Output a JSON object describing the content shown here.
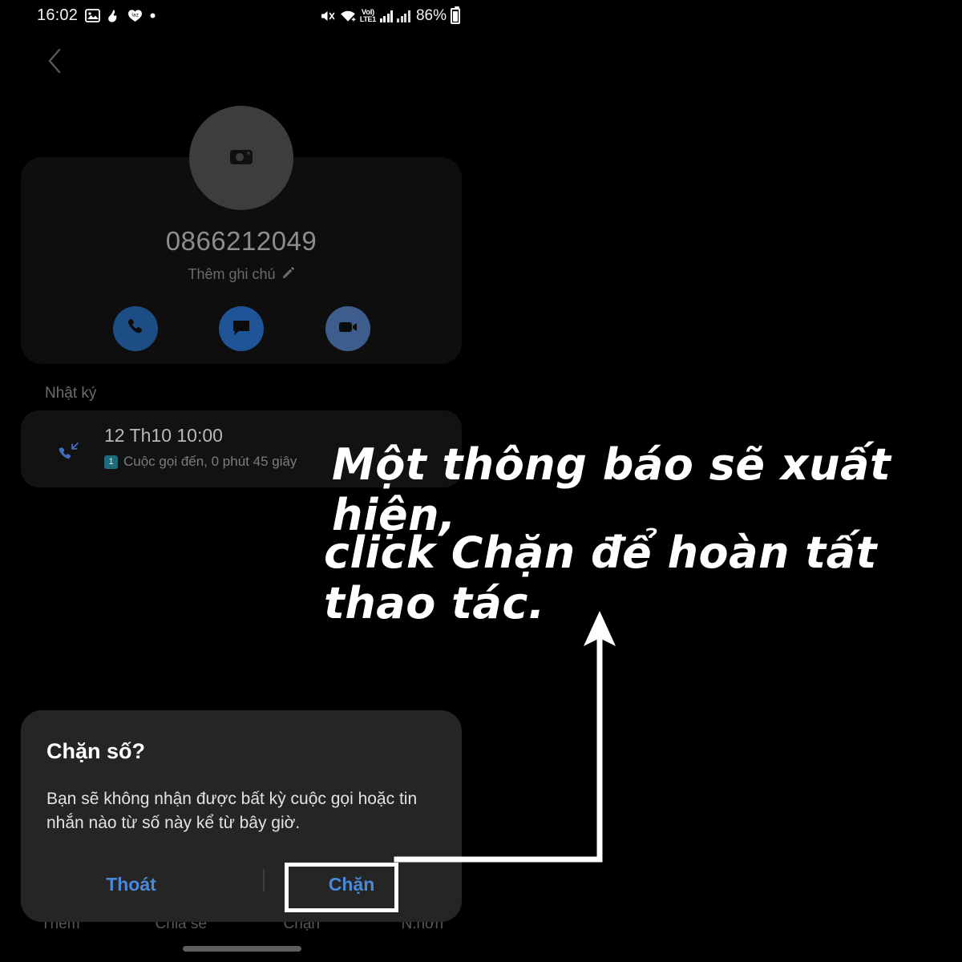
{
  "status_bar": {
    "time": "16:02",
    "battery_percent": "86%",
    "network_label_top": "VoI)",
    "network_label_bottom": "LTE1",
    "left_icons": [
      "gallery-icon",
      "app-icon",
      "lazada-icon",
      "dot-icon"
    ],
    "right_icons": [
      "mute-icon",
      "wifi-icon",
      "volte-icon",
      "signal-sim1-icon",
      "signal-sim2-icon",
      "battery-icon"
    ]
  },
  "nav": {
    "back_icon": "back-chevron-icon"
  },
  "contact": {
    "avatar_icon": "camera-icon",
    "number": "0866212049",
    "add_note": "Thêm ghi chú",
    "note_icon": "pencil-icon",
    "actions": [
      {
        "name": "call",
        "icon": "phone-icon",
        "color": "#1d4d85"
      },
      {
        "name": "message",
        "icon": "message-icon",
        "color": "#1f5596"
      },
      {
        "name": "video-call",
        "icon": "video-camera-icon",
        "color": "#3f5d8c"
      }
    ]
  },
  "call_log": {
    "section_title": "Nhật ký",
    "entries": [
      {
        "icon": "incoming-call-icon",
        "datetime": "12 Th10 10:00",
        "sim_badge": "1",
        "description": "Cuộc gọi đến, 0 phút 45 giây"
      }
    ]
  },
  "bottom_tabs": [
    {
      "label": "Thêm"
    },
    {
      "label": "Chia sẻ"
    },
    {
      "label": "Chặn"
    },
    {
      "label": "N.hơn"
    }
  ],
  "dialog": {
    "title": "Chặn số?",
    "body": "Bạn sẽ không nhận được bất kỳ cuộc gọi hoặc tin nhắn nào từ số này kể từ bây giờ.",
    "cancel_label": "Thoát",
    "confirm_label": "Chặn",
    "accent_color": "#4a89da"
  },
  "annotation": {
    "line1": "Một thông báo sẽ xuất hiện,",
    "line2": "click Chặn để hoàn tất thao tác.",
    "color": "#ffffff",
    "arrow": "callout-arrow",
    "highlight_target": "Chặn"
  }
}
